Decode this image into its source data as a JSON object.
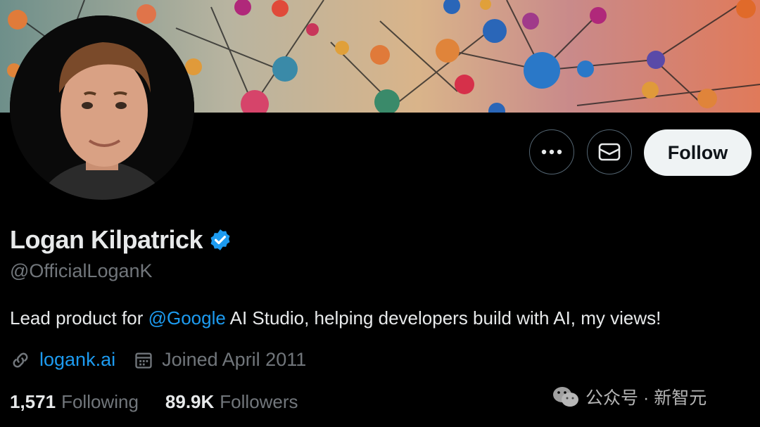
{
  "profile": {
    "name": "Logan Kilpatrick",
    "handle": "@OfficialLoganK",
    "bio_prefix": "Lead product for ",
    "bio_mention": "@Google",
    "bio_suffix": " AI Studio, helping developers build with AI, my views!",
    "website": "logank.ai",
    "joined": "Joined April 2011",
    "following_count": "1,571",
    "following_label": "Following",
    "followers_count": "89.9K",
    "followers_label": "Followers"
  },
  "actions": {
    "more_icon": "more-icon",
    "message_icon": "mail-icon",
    "follow_label": "Follow"
  },
  "watermark": {
    "text": "公众号 · 新智元"
  },
  "colors": {
    "background": "#000000",
    "link": "#1d9bf0",
    "verified": "#1d9bf0",
    "follow_bg": "#eff3f4",
    "muted_text": "#71767b"
  }
}
